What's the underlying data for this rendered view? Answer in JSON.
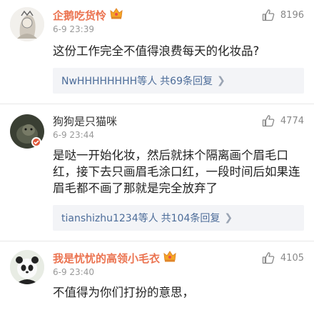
{
  "comments": [
    {
      "user": "企鹅吃货怜",
      "time": "6-9 23:39",
      "likes": "8196",
      "text": "这份工作完全不值得浪费每天的化妆品?",
      "reply_users": "NwHHHHHHHH等人",
      "reply_count": "共69条回复"
    },
    {
      "user": "狗狗是只猫咪",
      "time": "6-9 23:44",
      "likes": "4774",
      "text": "是哒一开始化妆，然后就抹个隔离画个眉毛口红，接下去只画眉毛涂口红，一段时间后如果连眉毛都不画了那就是完全放弃了",
      "reply_users": "tianshizhu1234等人",
      "reply_count": "共104条回复"
    },
    {
      "user": "我是忧忧的高领小毛衣",
      "time": "6-9 23:40",
      "likes": "4105",
      "text": "不值得为你们打扮的意思，"
    }
  ],
  "colors": {
    "vip_name": "#eb7350",
    "reply_link": "#4c6c99"
  }
}
